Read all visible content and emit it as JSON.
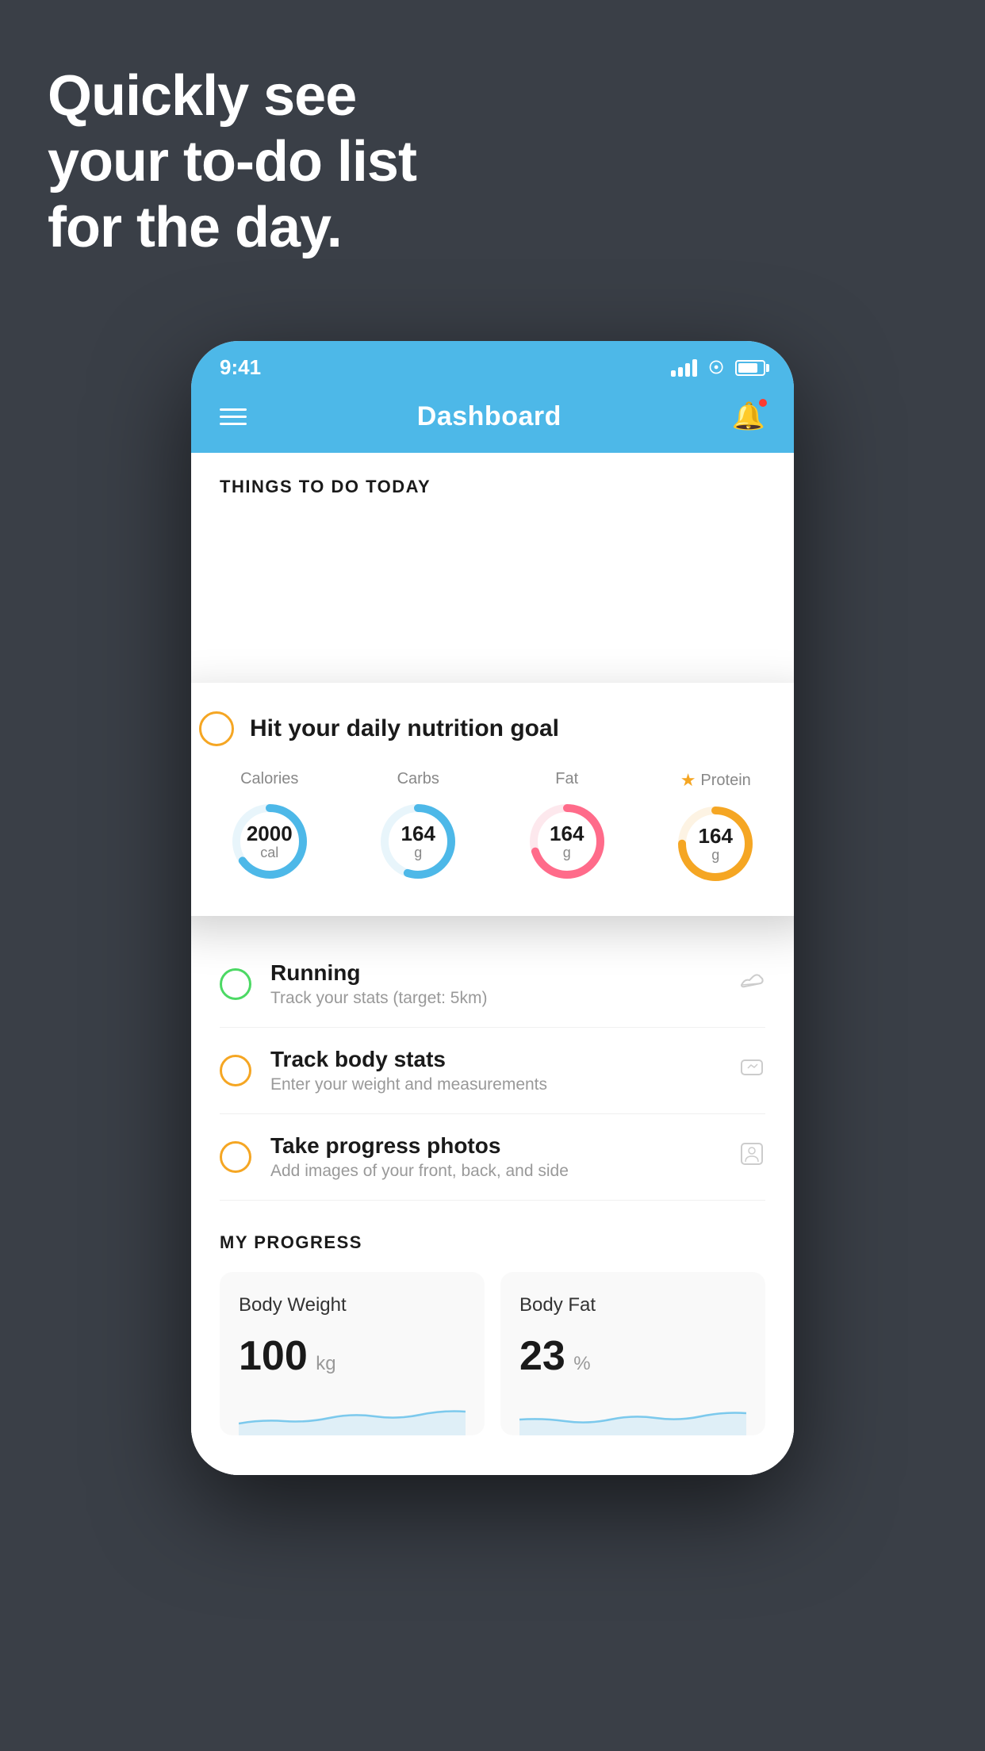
{
  "headline": {
    "line1": "Quickly see",
    "line2": "your to-do list",
    "line3": "for the day."
  },
  "status_bar": {
    "time": "9:41"
  },
  "nav_bar": {
    "title": "Dashboard"
  },
  "things_section": {
    "title": "THINGS TO DO TODAY"
  },
  "floating_card": {
    "title": "Hit your daily nutrition goal",
    "nutrients": [
      {
        "label": "Calories",
        "value": "2000",
        "unit": "cal",
        "color": "#4db8e8",
        "percent": 65,
        "star": false
      },
      {
        "label": "Carbs",
        "value": "164",
        "unit": "g",
        "color": "#4db8e8",
        "percent": 55,
        "star": false
      },
      {
        "label": "Fat",
        "value": "164",
        "unit": "g",
        "color": "#ff6b8a",
        "percent": 70,
        "star": false
      },
      {
        "label": "Protein",
        "value": "164",
        "unit": "g",
        "color": "#f5a623",
        "percent": 75,
        "star": true
      }
    ]
  },
  "todo_items": [
    {
      "title": "Running",
      "subtitle": "Track your stats (target: 5km)",
      "circle_color": "green",
      "icon": "shoe"
    },
    {
      "title": "Track body stats",
      "subtitle": "Enter your weight and measurements",
      "circle_color": "yellow",
      "icon": "scale"
    },
    {
      "title": "Take progress photos",
      "subtitle": "Add images of your front, back, and side",
      "circle_color": "yellow",
      "icon": "person"
    }
  ],
  "progress_section": {
    "title": "MY PROGRESS",
    "cards": [
      {
        "title": "Body Weight",
        "value": "100",
        "unit": "kg"
      },
      {
        "title": "Body Fat",
        "value": "23",
        "unit": "%"
      }
    ]
  }
}
